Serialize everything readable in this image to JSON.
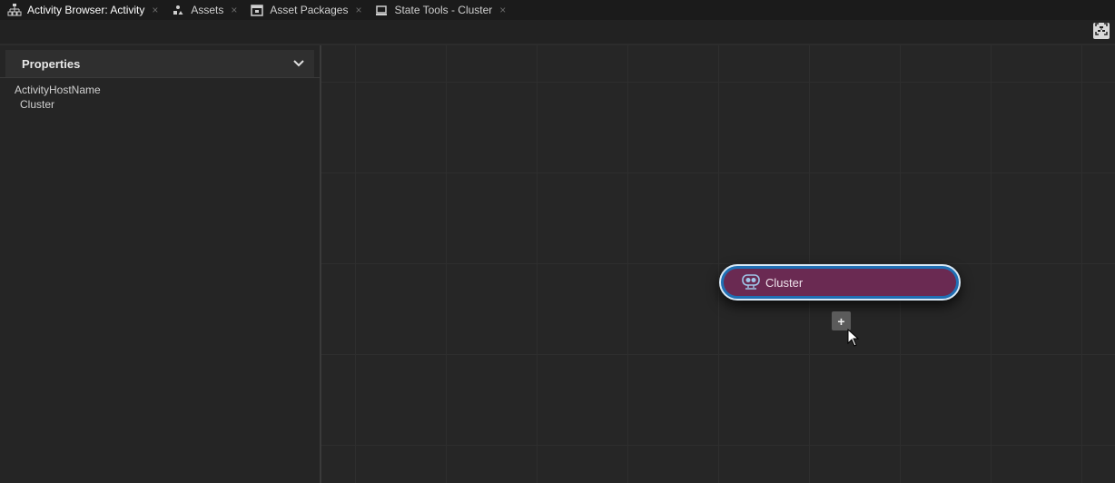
{
  "tabs": [
    {
      "label": "Activity Browser: Activity",
      "icon": "activity-tree-icon",
      "active": true
    },
    {
      "label": "Assets",
      "icon": "assets-icon",
      "active": false
    },
    {
      "label": "Asset Packages",
      "icon": "asset-packages-icon",
      "active": false
    },
    {
      "label": "State Tools - Cluster",
      "icon": "state-tools-icon",
      "active": false
    }
  ],
  "tab_close_glyph": "×",
  "toolbar": {
    "fit_icon": "fit-to-view-icon"
  },
  "properties": {
    "title": "Properties",
    "chevron_icon": "chevron-down-icon",
    "property_name": "ActivityHostName",
    "property_value": "Cluster"
  },
  "canvas": {
    "node": {
      "label": "Cluster",
      "icon": "cluster-icon"
    },
    "add_button": "+"
  },
  "colors": {
    "node_fill": "#6a2a52",
    "node_border": "#1f6fb4",
    "background": "#262626"
  }
}
